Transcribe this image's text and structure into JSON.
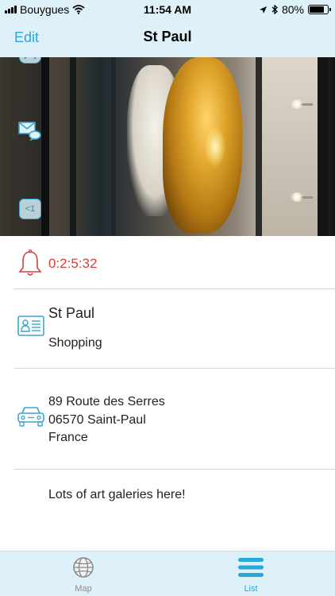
{
  "status_bar": {
    "carrier": "Bouygues",
    "time": "11:54 AM",
    "battery_percent": "80%",
    "battery_level": 0.8
  },
  "nav": {
    "edit_label": "Edit",
    "title": "St Paul"
  },
  "photo": {
    "badge_label": "<1"
  },
  "alarm": {
    "icon": "bell-icon",
    "time": "0:2:5:32",
    "color": "#d8403a"
  },
  "place": {
    "icon": "contact-card-icon",
    "name": "St Paul",
    "category": "Shopping"
  },
  "address": {
    "icon": "car-icon",
    "line1": "89 Route des Serres",
    "line2": "06570 Saint-Paul",
    "line3": "France"
  },
  "note": {
    "text": "Lots of art galeries here!"
  },
  "tabs": [
    {
      "label": "Map",
      "icon": "globe-icon",
      "active": false
    },
    {
      "label": "List",
      "icon": "list-icon",
      "active": true
    }
  ],
  "colors": {
    "accent": "#2aa8dc",
    "bar_background": "#dff1f8",
    "alert": "#d8403a"
  }
}
